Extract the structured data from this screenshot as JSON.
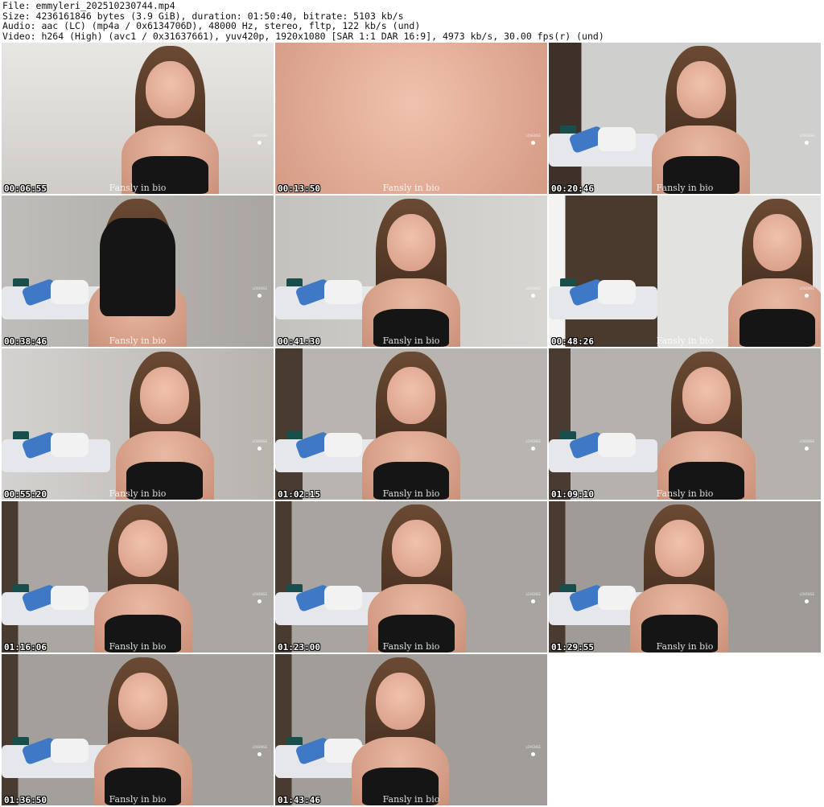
{
  "header": {
    "line1": "File: emmyleri_202510230744.mp4",
    "line2": "Size: 4236161846 bytes (3.9 GiB), duration: 01:50:40, bitrate: 5103 kb/s",
    "line3": "Audio: aac (LC) (mp4a / 0x6134706D), 48000 Hz, stereo, fltp, 122 kb/s (und)",
    "line4": "Video: h264 (High) (avc1 / 0x31637661), yuv420p, 1920x1080 [SAR 1:1 DAR 16:9], 4973 kb/s, 30.00 fps(r) (und)"
  },
  "watermark": "Fansly in bio",
  "logo_text": "LOVENSE",
  "thumbnails": [
    {
      "timestamp": "00:06:55"
    },
    {
      "timestamp": "00:13:50"
    },
    {
      "timestamp": "00:20:46"
    },
    {
      "timestamp": "00:38:46"
    },
    {
      "timestamp": "00:41:30"
    },
    {
      "timestamp": "00:48:26"
    },
    {
      "timestamp": "00:55:20"
    },
    {
      "timestamp": "01:02:15"
    },
    {
      "timestamp": "01:09:10"
    },
    {
      "timestamp": "01:16:06"
    },
    {
      "timestamp": "01:23:00"
    },
    {
      "timestamp": "01:29:55"
    },
    {
      "timestamp": "01:36:50"
    },
    {
      "timestamp": "01:43:46"
    }
  ]
}
